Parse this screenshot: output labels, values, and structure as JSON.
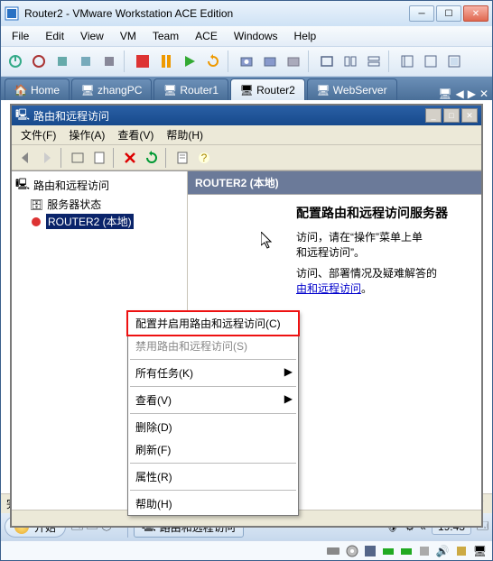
{
  "app_title": "Router2 - VMware Workstation ACE Edition",
  "outer_menu": [
    "File",
    "Edit",
    "View",
    "VM",
    "Team",
    "ACE",
    "Windows",
    "Help"
  ],
  "tabs": [
    {
      "label": "Home"
    },
    {
      "label": "zhangPC"
    },
    {
      "label": "Router1"
    },
    {
      "label": "Router2"
    },
    {
      "label": "WebServer"
    }
  ],
  "active_tab_index": 3,
  "inner": {
    "title": "路由和远程访问",
    "menu": [
      "文件(F)",
      "操作(A)",
      "查看(V)",
      "帮助(H)"
    ],
    "tree": {
      "root": "路由和远程访问",
      "n1": "服务器状态",
      "n2": "ROUTER2 (本地)"
    },
    "right": {
      "header": "ROUTER2 (本地)",
      "heading": "配置路由和远程访问服务器",
      "line1a": "访问，请在“操作”菜单上单",
      "line1b": "和远程访问”。",
      "line2a": "访问、部署情况及疑难解答的",
      "link": "由和远程访问",
      "line2b": "。"
    }
  },
  "ctx": {
    "configure": "配置并启用路由和远程访问(C)",
    "disable": "禁用路由和远程访问(S)",
    "alltasks": "所有任务(K)",
    "view": "查看(V)",
    "delete": "删除(D)",
    "refresh": "刷新(F)",
    "props": "属性(R)",
    "help": "帮助(H)"
  },
  "status_done": "完成",
  "task_app": "路由和远程访问",
  "start_label": "开始",
  "clock": "19:43"
}
